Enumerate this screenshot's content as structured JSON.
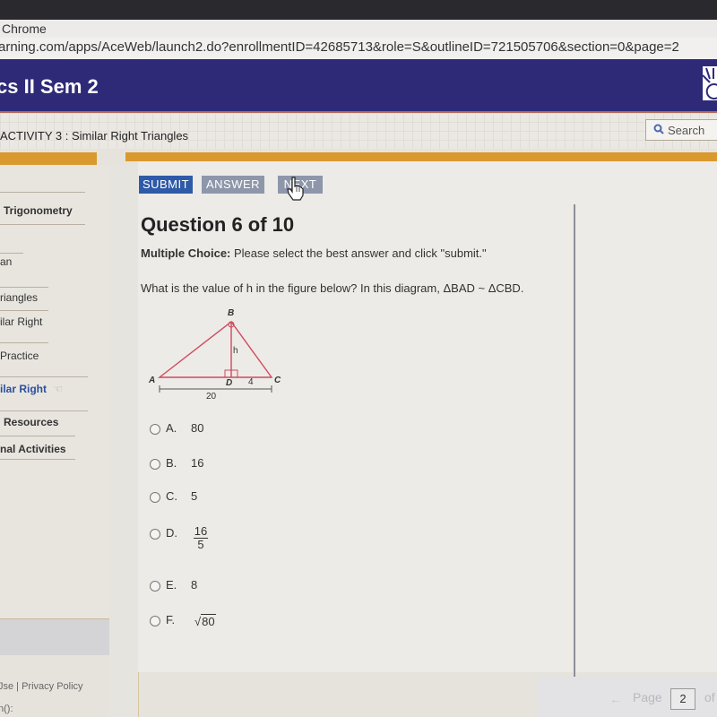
{
  "browser": {
    "window_title": "Chrome",
    "url": "arning.com/apps/AceWeb/launch2.do?enrollmentID=42685713&role=S&outlineID=721505706&section=0&page=2"
  },
  "header": {
    "course_title": "cs II  Sem 2",
    "brand_color": "#2e2a78"
  },
  "subheader": {
    "activity_label": "ACTIVITY 3",
    "activity_separator": ":",
    "activity_title": "Similar Right Triangles",
    "search_label": "Search"
  },
  "sidebar": {
    "items": [
      {
        "label": "Trigonometry",
        "style": "bold"
      },
      {
        "label": "an",
        "style": "normal"
      },
      {
        "label": "riangles",
        "style": "normal"
      },
      {
        "label": "ilar Right",
        "style": "normal"
      },
      {
        "label": "Practice",
        "style": "normal"
      },
      {
        "label": "ilar Right",
        "style": "active"
      },
      {
        "label": "Resources",
        "style": "bold"
      },
      {
        "label": "nal Activities",
        "style": "bold"
      }
    ],
    "footer_links": "Jse  |  Privacy Policy",
    "footer_sub": "n():"
  },
  "toolbar": {
    "submit_label": "SUBMIT",
    "answer_label": "ANSWER",
    "next_label": "NEXT"
  },
  "question": {
    "title": "Question 6 of 10",
    "instruction_prefix": "Multiple Choice:",
    "instruction_text": " Please select the best answer and click \"submit.\"",
    "prompt": "What is the value of h in the figure below? In this diagram, ΔBAD ~ ΔCBD.",
    "figure": {
      "vertices": [
        "A",
        "B",
        "C",
        "D"
      ],
      "height_label": "h",
      "segment_dc": "4",
      "segment_ac": "20"
    },
    "choices": [
      {
        "letter": "A.",
        "value": "80"
      },
      {
        "letter": "B.",
        "value": "16"
      },
      {
        "letter": "C.",
        "value": "5"
      },
      {
        "letter": "D.",
        "numerator": "16",
        "denominator": "5"
      },
      {
        "letter": "E.",
        "value": "8"
      },
      {
        "letter": "F.",
        "radicand": "80",
        "radical": "√"
      }
    ]
  },
  "pager": {
    "prev_icon": "←",
    "page_label": "Page",
    "current_page": "2",
    "of_label": "of"
  }
}
